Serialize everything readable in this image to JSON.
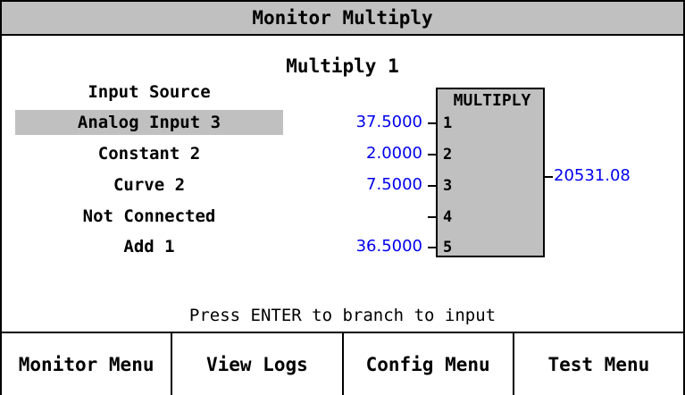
{
  "title": "Monitor Multiply",
  "subtitle": "Multiply 1",
  "inputs_header": "Input Source",
  "inputs": [
    {
      "source": "Analog Input 3",
      "value": "37.5000",
      "pin": "1",
      "selected": true
    },
    {
      "source": "Constant 2",
      "value": "2.0000",
      "pin": "2"
    },
    {
      "source": "Curve 2",
      "value": "7.5000",
      "pin": "3"
    },
    {
      "source": "Not Connected",
      "value": "",
      "pin": "4"
    },
    {
      "source": "Add 1",
      "value": "36.5000",
      "pin": "5"
    }
  ],
  "block": {
    "title": "MULTIPLY",
    "output": "20531.08"
  },
  "hint": "Press ENTER to branch to input",
  "softkeys": [
    "Monitor Menu",
    "View Logs",
    "Config Menu",
    "Test Menu"
  ],
  "colors": {
    "value": "#0000ee",
    "selected": "#c0c0c0",
    "block": "#c0c0c0"
  }
}
